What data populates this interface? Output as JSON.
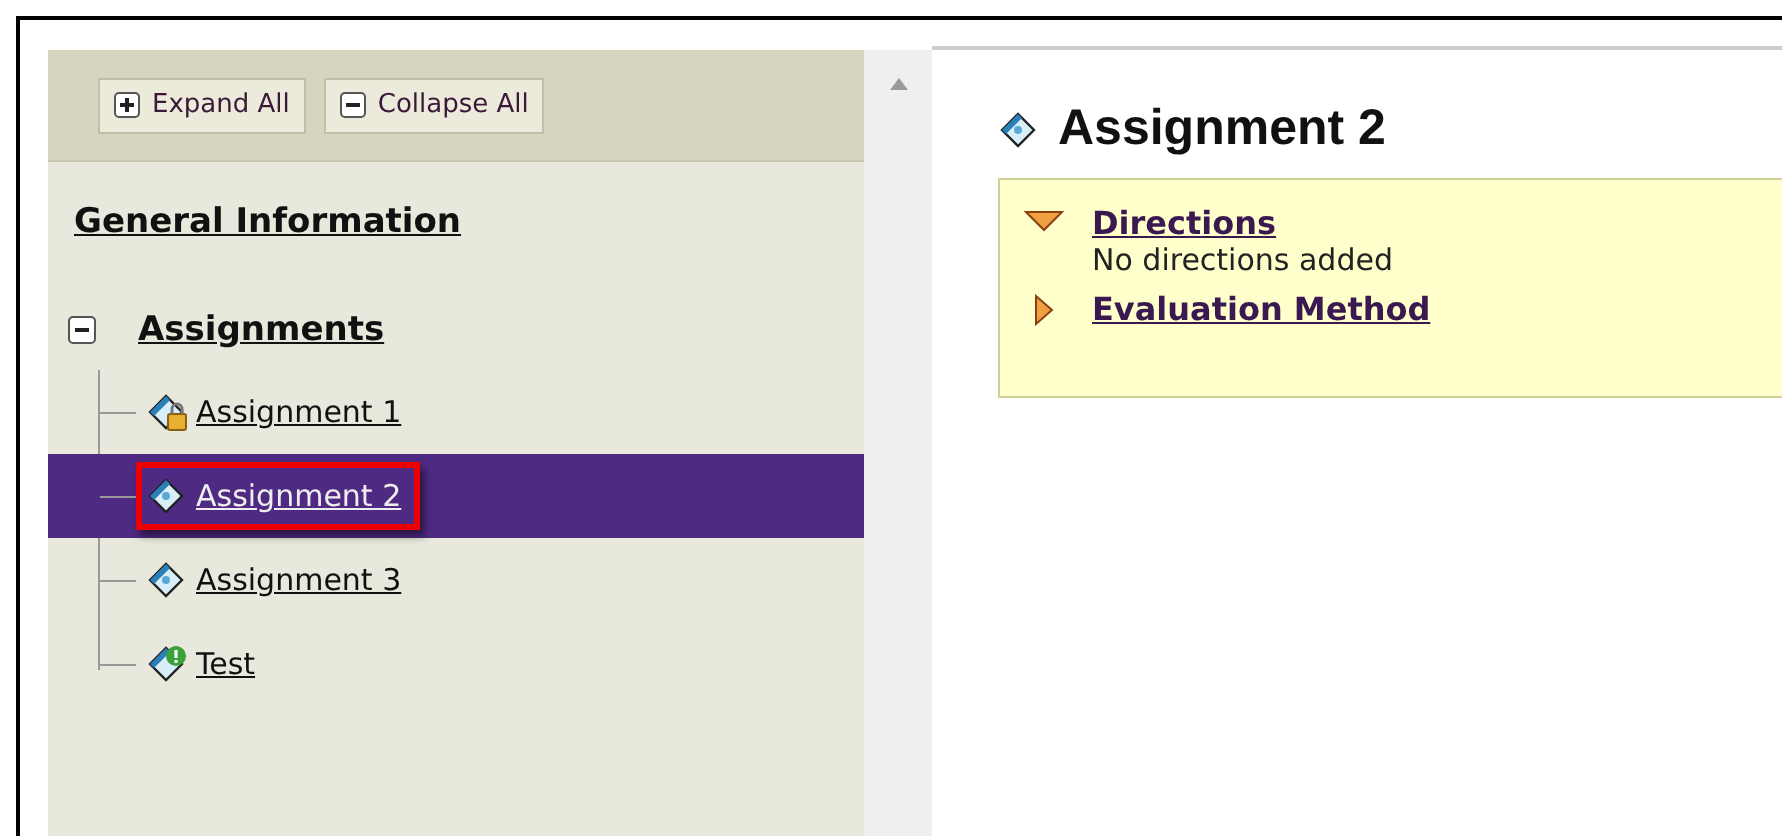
{
  "toolbar": {
    "buttons": [
      {
        "kind": "expand",
        "label": "Expand All"
      },
      {
        "kind": "collapse",
        "label": "Collapse All"
      }
    ]
  },
  "sidebar": {
    "heading": "General Information",
    "group": {
      "label": "Assignments",
      "expanded": true,
      "children": [
        {
          "kind": "locked",
          "label": "Assignment 1",
          "selected": false,
          "highlighted": false
        },
        {
          "kind": "assignment",
          "label": "Assignment 2",
          "selected": true,
          "highlighted": true
        },
        {
          "kind": "assignment",
          "label": "Assignment 3",
          "selected": false,
          "highlighted": false
        },
        {
          "kind": "test",
          "label": "Test",
          "selected": false,
          "highlighted": false
        }
      ]
    }
  },
  "content": {
    "title": "Assignment 2",
    "sections": [
      {
        "label": "Directions",
        "expanded": true,
        "body": "No directions added"
      },
      {
        "label": "Evaluation Method",
        "expanded": false
      }
    ]
  }
}
